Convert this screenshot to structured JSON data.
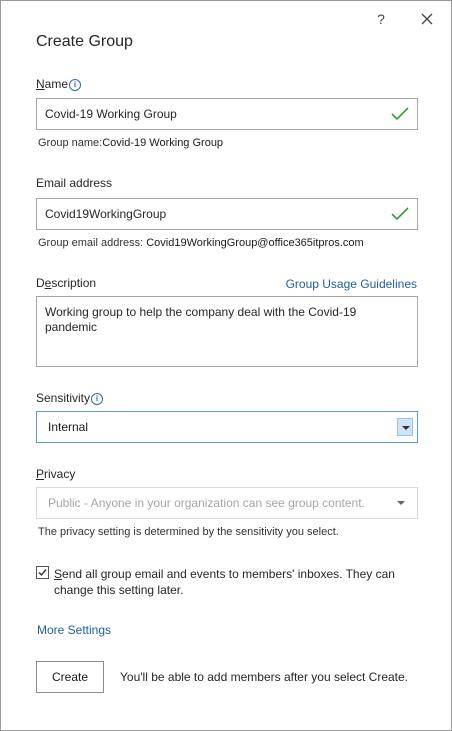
{
  "dialog": {
    "title": "Create Group",
    "help_label": "?"
  },
  "name": {
    "label_ul": "N",
    "label_rest": "ame",
    "value": "Covid-19 Working Group",
    "hint_label": "Group name:",
    "hint_value": "Covid-19 Working Group"
  },
  "email": {
    "label": "Email address",
    "value": "Covid19WorkingGroup",
    "hint_label": "Group email address:",
    "hint_value": "Covid19WorkingGroup@office365itpros.com"
  },
  "description": {
    "label_pre": "D",
    "label_ul": "e",
    "label_rest": "scription",
    "guidelines_link": "Group Usage Guidelines",
    "value": "Working group to help the company deal with the Covid-19 pandemic"
  },
  "sensitivity": {
    "label": "Sensitivity",
    "selected": "Internal"
  },
  "privacy": {
    "label_ul": "P",
    "label_rest": "rivacy",
    "selected": "Public - Anyone in your organization can see group content.",
    "note": "The privacy setting is determined by the sensitivity you select."
  },
  "subscribe": {
    "checked": true,
    "label_ul": "S",
    "label_rest": "end all group email and events to members' inboxes. They can change this setting later."
  },
  "more_settings_link": "More Settings",
  "footer": {
    "create_label": "Create",
    "note": "You'll be able to add members after you select Create."
  },
  "colors": {
    "accent": "#1e5f9e",
    "valid_check": "#3a9a3a",
    "focus_border": "#5b9bd5"
  }
}
